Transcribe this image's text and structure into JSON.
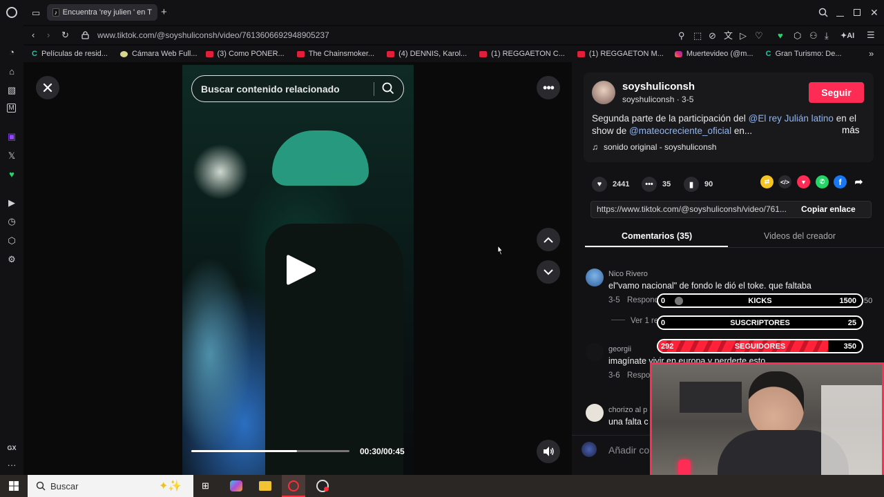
{
  "browser": {
    "tab_title": "Encuentra 'rey julien ' en T",
    "new_tab": "+",
    "url": "www.tiktok.com/@soyshuliconsh/video/7613606692948905237",
    "ai_label": "AI",
    "bookmarks": [
      {
        "label": "Películas de resid...",
        "icon": "c"
      },
      {
        "label": "Cámara Web Full...",
        "icon": "g"
      },
      {
        "label": "(3) Como PONER...",
        "icon": "yt"
      },
      {
        "label": "The Chainsmoker...",
        "icon": "yt"
      },
      {
        "label": "(4) DENNIS, Karol...",
        "icon": "yt"
      },
      {
        "label": "(1) REGGAETON C...",
        "icon": "yt"
      },
      {
        "label": "(1) REGGAETON M...",
        "icon": "yt"
      },
      {
        "label": "Muertevideo (@m...",
        "icon": "ig"
      },
      {
        "label": "Gran Turismo: De...",
        "icon": "c"
      }
    ],
    "sidebar_gx": "GX"
  },
  "player": {
    "search_placeholder": "Buscar contenido relacionado",
    "time": "00:30/00:45",
    "progress": 0.67
  },
  "post": {
    "username": "soyshuliconsh",
    "handle_date": "soyshuliconsh · 3-5",
    "follow_label": "Seguir",
    "desc_1": "Segunda parte de la participación del ",
    "mention_1": "@El rey Julián latino",
    "desc_2": " en el show de ",
    "mention_2": "@mateocreciente_oficial",
    "desc_3": " en...",
    "more_label": "más",
    "music": "sonido original - soyshuliconsh",
    "likes": "2441",
    "comments": "35",
    "saves": "90",
    "link": "https://www.tiktok.com/@soyshuliconsh/video/761...",
    "copy_link": "Copiar enlace"
  },
  "tabs": {
    "comments": "Comentarios (35)",
    "creator_videos": "Videos del creador"
  },
  "comments": [
    {
      "name": "Nico Rivero",
      "text": "el\"vamo nacional\" de fondo le dió el toke. que faltaba",
      "date": "3-5",
      "reply": "Responder",
      "replies": "Ver 1 respuesta"
    },
    {
      "name": "georgii",
      "text": "imagínate vivir en europa y perderte esto",
      "date": "3-6",
      "reply": "Responder"
    },
    {
      "name": "chorizo al p",
      "text": "una falta c"
    }
  ],
  "add_comment": "Añadir comentario...",
  "overlay": {
    "kicks": {
      "label": "KICKS",
      "left": "0",
      "right": "1500",
      "extra": "50"
    },
    "subs": {
      "label": "SUSCRIPTORES",
      "left": "0",
      "right": "25"
    },
    "followers": {
      "label": "SEGUIDORES",
      "left": "292",
      "right": "350",
      "fill": 0.834
    }
  },
  "taskbar": {
    "search": "Buscar"
  }
}
